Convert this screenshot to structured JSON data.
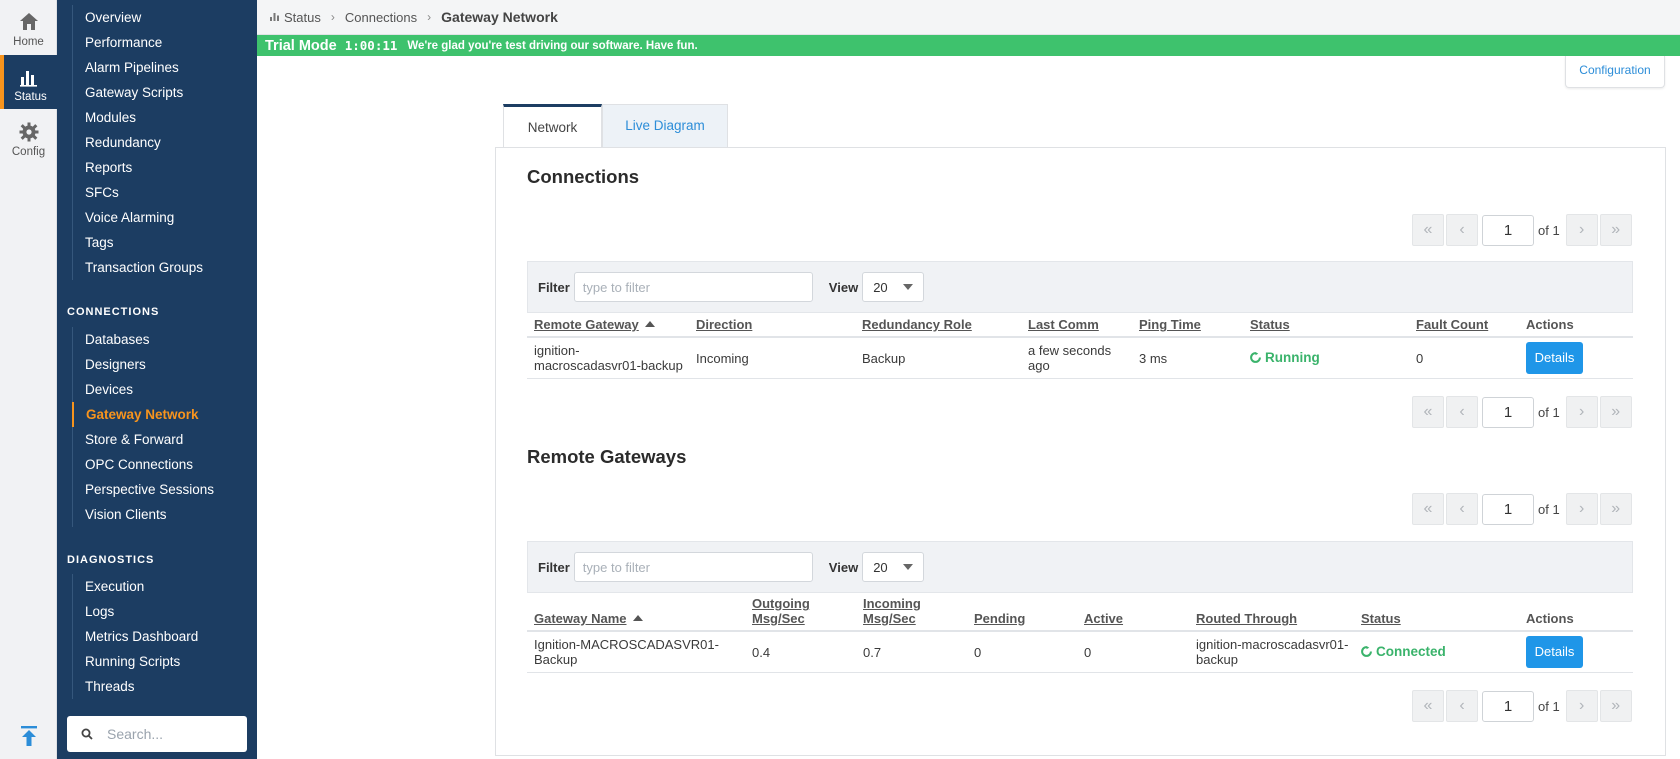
{
  "rail": {
    "home_label": "Home",
    "status_label": "Status",
    "config_label": "Config"
  },
  "nav": {
    "items_top": [
      "Overview",
      "Performance",
      "Alarm Pipelines",
      "Gateway Scripts",
      "Modules",
      "Redundancy",
      "Reports",
      "SFCs",
      "Voice Alarming",
      "Tags",
      "Transaction Groups"
    ],
    "connections_heading": "CONNECTIONS",
    "items_connections": [
      "Databases",
      "Designers",
      "Devices",
      "Gateway Network",
      "Store & Forward",
      "OPC Connections",
      "Perspective Sessions",
      "Vision Clients"
    ],
    "diagnostics_heading": "DIAGNOSTICS",
    "items_diagnostics": [
      "Execution",
      "Logs",
      "Metrics Dashboard",
      "Running Scripts",
      "Threads"
    ],
    "search_placeholder": "Search..."
  },
  "header": {
    "crumb_status": "Status",
    "crumb_connections": "Connections",
    "crumb_current": "Gateway Network"
  },
  "trial": {
    "label": "Trial Mode",
    "time": "1:00:11",
    "message": "We're glad you're test driving our software. Have fun."
  },
  "configuration_button": "Configuration",
  "tabs": {
    "network": "Network",
    "live_diagram": "Live Diagram"
  },
  "pager": {
    "first": "«",
    "prev": "‹",
    "next": "›",
    "last": "»",
    "page": "1",
    "of": "of 1"
  },
  "filter": {
    "label": "Filter",
    "placeholder": "type to filter",
    "view_label": "View",
    "view_value": "20"
  },
  "connections": {
    "title": "Connections",
    "columns": [
      "Remote Gateway",
      "Direction",
      "Redundancy Role",
      "Last Comm",
      "Ping Time",
      "Status",
      "Fault Count",
      "Actions"
    ],
    "rows": [
      {
        "remote_gateway": "ignition-\nmacroscadasvr01-backup",
        "direction": "Incoming",
        "redundancy_role": "Backup",
        "last_comm": "a few seconds\nago",
        "ping_time": "3 ms",
        "status": "Running",
        "fault_count": "0",
        "action": "Details"
      }
    ]
  },
  "remote_gateways": {
    "title": "Remote Gateways",
    "columns": [
      "Gateway Name",
      "Outgoing\nMsg/Sec",
      "Incoming\nMsg/Sec",
      "Pending",
      "Active",
      "Routed Through",
      "Status",
      "Actions"
    ],
    "rows": [
      {
        "gateway_name": "Ignition-MACROSCADASVR01-\nBackup",
        "outgoing": "0.4",
        "incoming": "0.7",
        "pending": "0",
        "active": "0",
        "routed_through": "ignition-macroscadasvr01-\nbackup",
        "status": "Connected",
        "action": "Details"
      }
    ]
  }
}
